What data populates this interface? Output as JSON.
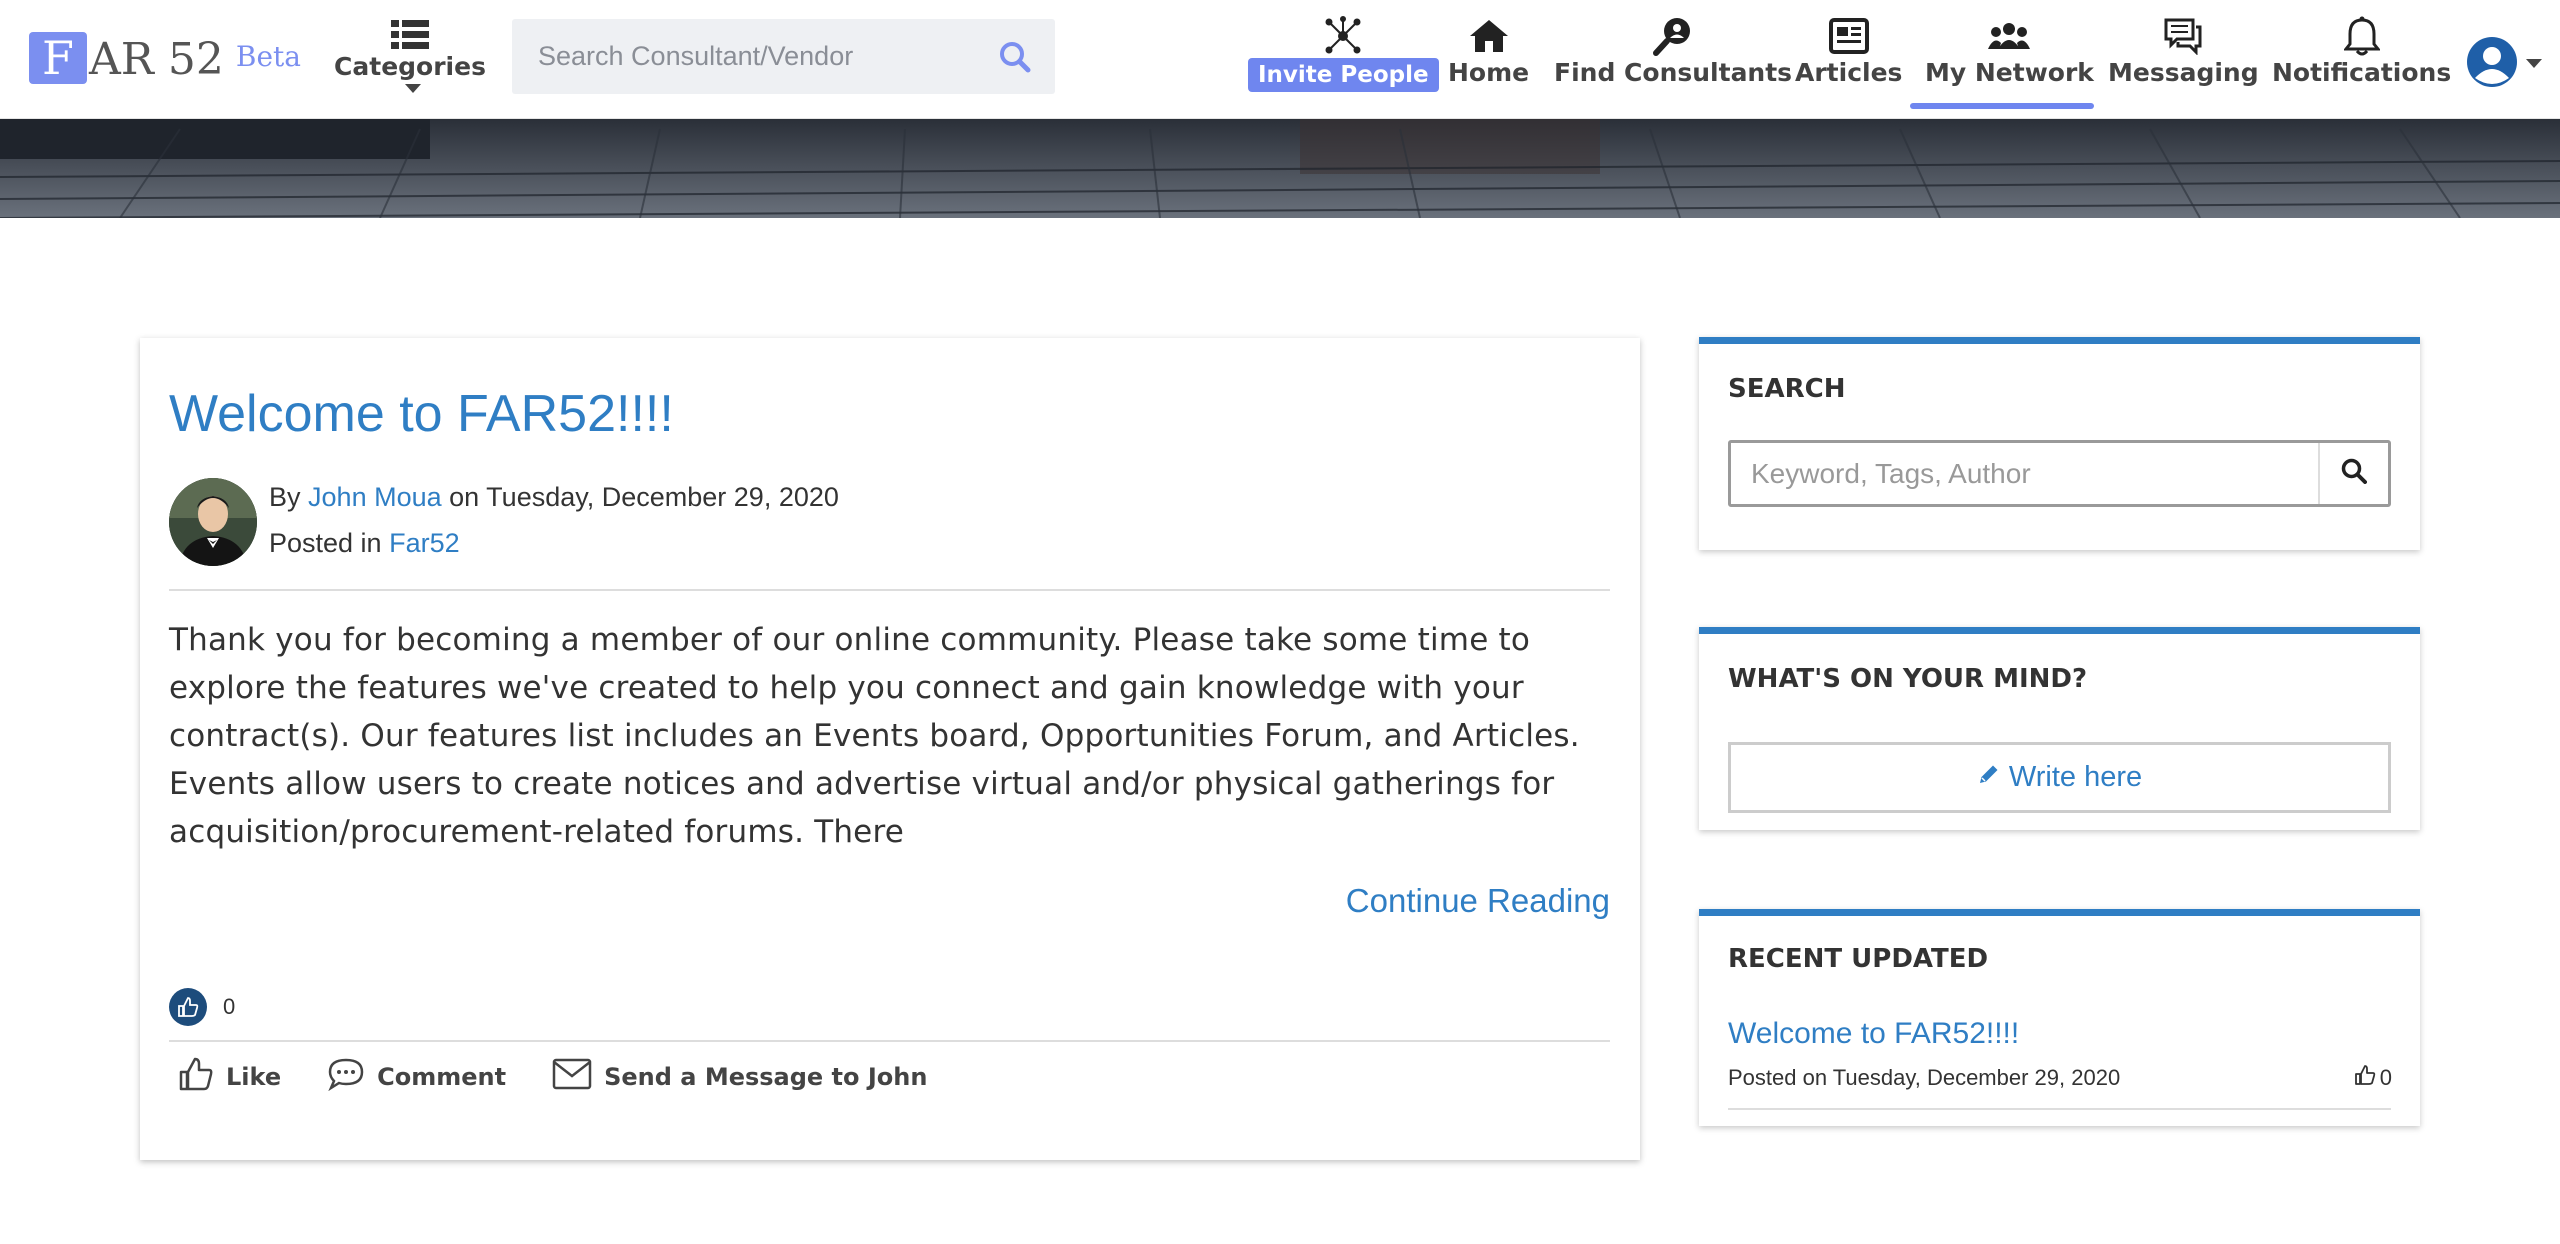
{
  "nav": {
    "logo_letter": "F",
    "logo_rest": "AR 52",
    "logo_beta": "Beta",
    "categories_label": "Categories",
    "search_placeholder": "Search Consultant/Vendor",
    "invite_label": "Invite People",
    "home_label": "Home",
    "find_consultants_label": "Find Consultants",
    "articles_label": "Articles",
    "my_network_label": "My Network",
    "messaging_label": "Messaging",
    "notifications_label": "Notifications",
    "active_item": "My Network"
  },
  "post": {
    "title": "Welcome to FAR52!!!!",
    "by_prefix": "By",
    "author": "John Moua",
    "date_text": "on Tuesday, December 29, 2020",
    "posted_in_prefix": "Posted in",
    "category": "Far52",
    "excerpt": "Thank you for becoming a member of our online community. Please take some time to explore the features we've created to help you connect and gain knowledge with your contract(s). Our features list includes an Events board, Opportunities Forum, and Articles. Events allow users to create notices and advertise virtual and/or physical gatherings for acquisition/procurement-related forums. There",
    "continue_label": "Continue Reading",
    "like_count": "0",
    "actions": {
      "like": "Like",
      "comment": "Comment",
      "message": "Send a Message to John"
    }
  },
  "sidebar": {
    "search": {
      "title": "SEARCH",
      "placeholder": "Keyword, Tags, Author"
    },
    "mind": {
      "title": "WHAT'S ON YOUR MIND?",
      "button": "Write here"
    },
    "recent": {
      "title": "RECENT UPDATED",
      "item_title": "Welcome to FAR52!!!!",
      "item_meta": "Posted on Tuesday, December 29, 2020",
      "item_likes": "0"
    }
  },
  "colors": {
    "accent": "#6f86ef",
    "link": "#2f7ec4",
    "widget_border": "#2f7ec4"
  }
}
